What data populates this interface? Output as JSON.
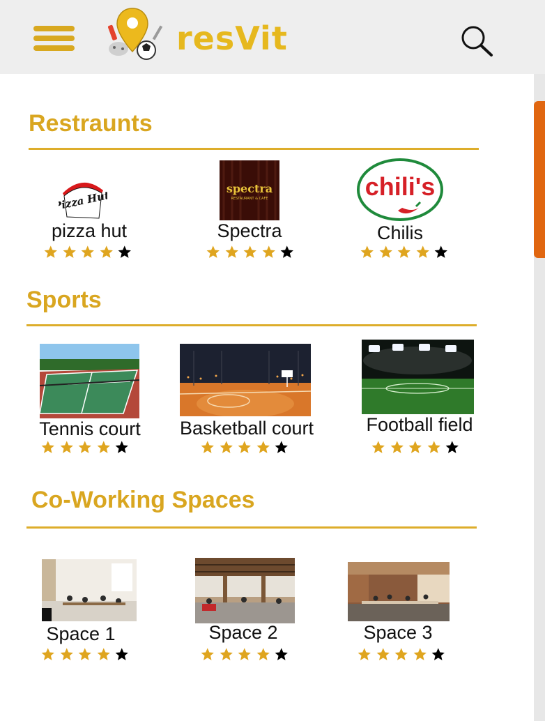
{
  "app": {
    "name": "resVit"
  },
  "colors": {
    "accent": "#d9a620",
    "star_filled": "#dfa51f",
    "star_empty": "#000000",
    "scroll_thumb": "#e06610"
  },
  "header": {
    "menu_icon": "hamburger-icon",
    "search_icon": "search-icon"
  },
  "sections": [
    {
      "title": "Restraunts",
      "items": [
        {
          "name": "pizza hut",
          "rating": 4,
          "max_rating": 5,
          "image": "pizza-hut-logo",
          "logo_text": "Pizza Hut"
        },
        {
          "name": "Spectra",
          "rating": 4,
          "max_rating": 5,
          "image": "spectra-logo",
          "logo_text": "spectra",
          "logo_sub": "RESTAURANT & CAFE"
        },
        {
          "name": "Chilis",
          "rating": 4,
          "max_rating": 5,
          "image": "chilis-logo",
          "logo_text": "chili's"
        }
      ]
    },
    {
      "title": "Sports",
      "items": [
        {
          "name": "Tennis court",
          "rating": 4,
          "max_rating": 5,
          "image": "tennis-court-photo"
        },
        {
          "name": "Basketball court",
          "rating": 4,
          "max_rating": 5,
          "image": "basketball-court-photo"
        },
        {
          "name": "Football field",
          "rating": 4,
          "max_rating": 5,
          "image": "football-field-photo"
        }
      ]
    },
    {
      "title": "Co-Working Spaces",
      "items": [
        {
          "name": "Space 1",
          "rating": 4,
          "max_rating": 5,
          "image": "coworking-space-photo"
        },
        {
          "name": "Space 2",
          "rating": 4,
          "max_rating": 5,
          "image": "coworking-space-photo"
        },
        {
          "name": "Space 3",
          "rating": 4,
          "max_rating": 5,
          "image": "coworking-space-photo"
        }
      ]
    }
  ]
}
